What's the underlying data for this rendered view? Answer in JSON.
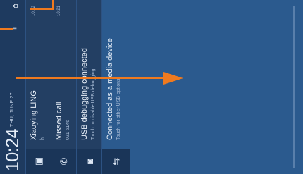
{
  "status": {
    "time": "10:24",
    "date": "THU, JUNE 27"
  },
  "notifications": [
    {
      "title": "Xiaoying LING",
      "subtitle": "hi",
      "time": "10:22",
      "icon": "message-icon"
    },
    {
      "title": "Missed call",
      "subtitle": "021 6146",
      "time": "10:21",
      "icon": "missed-call-icon"
    },
    {
      "title": "USB debugging connected",
      "subtitle": "Touch to disable USB debugging.",
      "time": "",
      "icon": "bug-icon"
    },
    {
      "title": "Connected as a media device",
      "subtitle": "Touch for other USB options",
      "time": "",
      "icon": "usb-icon"
    }
  ],
  "colors": {
    "accent": "#ef7a1f",
    "background": "#2b5a8e",
    "shade": "#233f63"
  }
}
